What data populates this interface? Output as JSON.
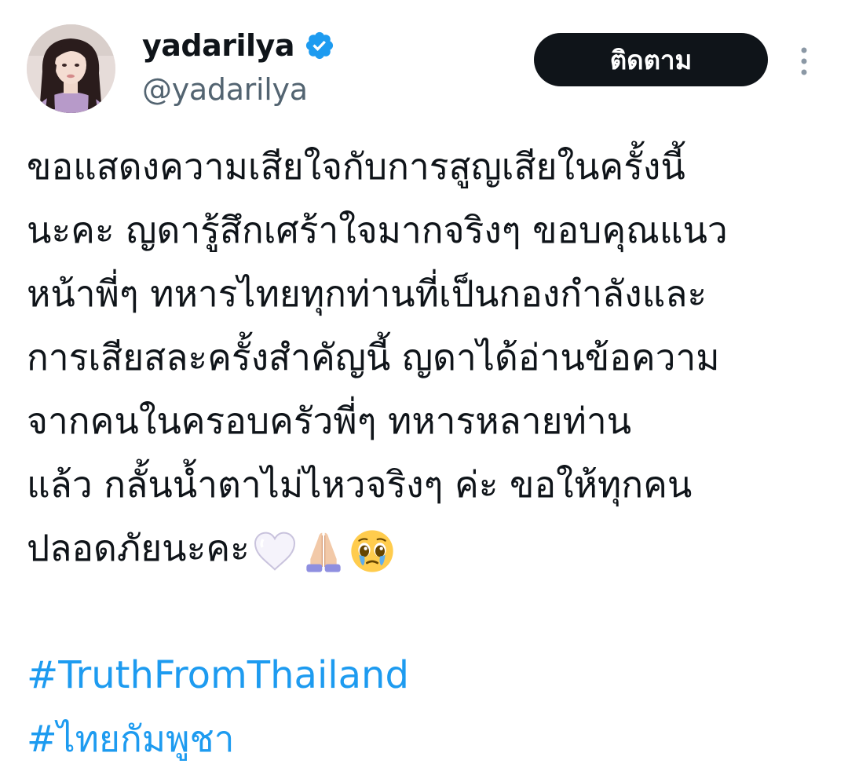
{
  "user": {
    "display_name": "yadarilya",
    "handle": "@yadarilya",
    "verified": true
  },
  "actions": {
    "follow_label": "ติดตาม"
  },
  "tweet": {
    "lines": [
      "ขอแสดงความเสียใจกับการสูญเสียในครั้งนี้",
      "นะคะ ญดารู้สึกเศร้าใจมากจริงๆ ขอบคุณแนว",
      "หน้าพี่ๆ ทหารไทยทุกท่านที่เป็นกองกำลังและ",
      "การเสียสละครั้งสำคัญนี้ ญดาได้อ่านข้อความ",
      "จากคนในครอบครัวพี่ๆ ทหารหลายท่าน",
      "แล้ว กลั้นน้ำตาไม่ไหวจริงๆ ค่ะ ขอให้ทุกคน",
      "ปลอดภัยนะคะ"
    ],
    "emojis": [
      "white-heart-icon",
      "folded-hands-icon",
      "pleading-face-icon"
    ],
    "hashtags": [
      "#TruthFromThailand",
      "#ไทยกัมพูชา"
    ]
  },
  "colors": {
    "text": "#0f1419",
    "secondary": "#536471",
    "link": "#1d9bf0",
    "button_bg": "#0f1419",
    "verified": "#1d9bf0"
  }
}
